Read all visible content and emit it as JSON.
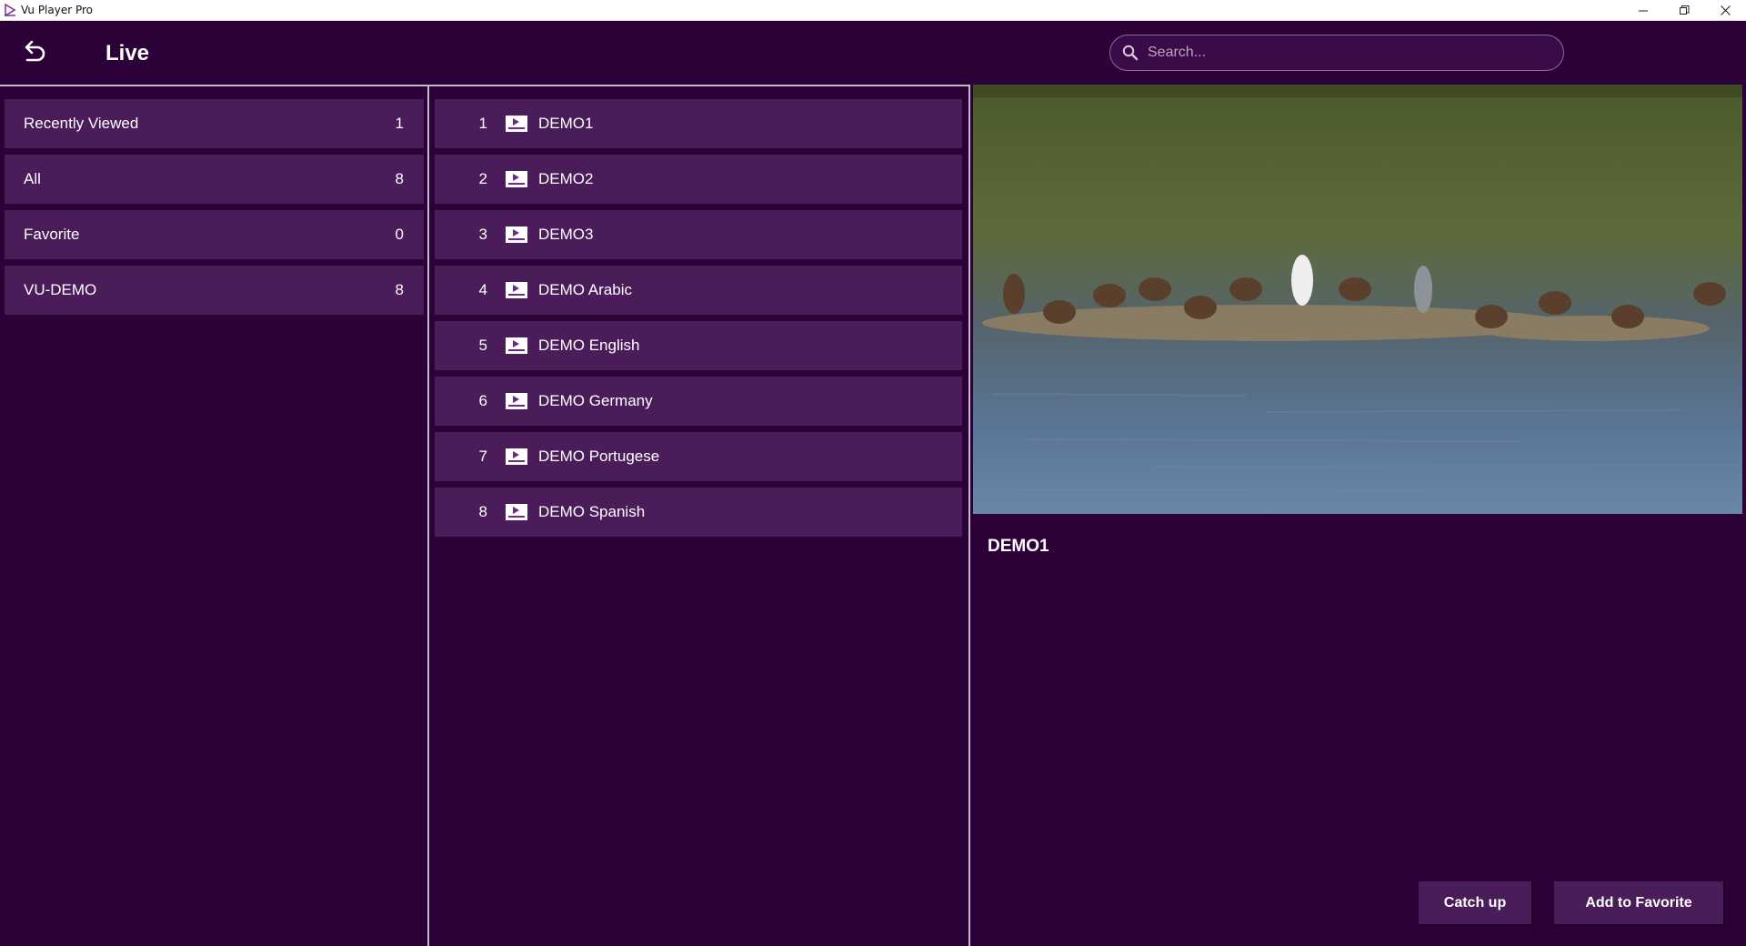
{
  "window": {
    "title": "Vu Player Pro",
    "controls": [
      "minimize-icon",
      "restore-icon",
      "close-icon"
    ]
  },
  "header": {
    "title": "Live",
    "search_placeholder": "Search..."
  },
  "categories": [
    {
      "label": "Recently Viewed",
      "count": "1"
    },
    {
      "label": "All",
      "count": "8"
    },
    {
      "label": "Favorite",
      "count": "0"
    },
    {
      "label": "VU-DEMO",
      "count": "8"
    }
  ],
  "channels": [
    {
      "num": "1",
      "name": "DEMO1"
    },
    {
      "num": "2",
      "name": "DEMO2"
    },
    {
      "num": "3",
      "name": "DEMO3"
    },
    {
      "num": "4",
      "name": "DEMO Arabic"
    },
    {
      "num": "5",
      "name": "DEMO English"
    },
    {
      "num": "6",
      "name": "DEMO Germany"
    },
    {
      "num": "7",
      "name": "DEMO Portugese"
    },
    {
      "num": "8",
      "name": "DEMO Spanish"
    }
  ],
  "preview": {
    "now_playing": "DEMO1"
  },
  "actions": {
    "catch_up": "Catch up",
    "add_favorite": "Add to Favorite"
  },
  "colors": {
    "background": "#2b0138",
    "item": "#4a1d5a",
    "divider": "#c7bacb"
  }
}
